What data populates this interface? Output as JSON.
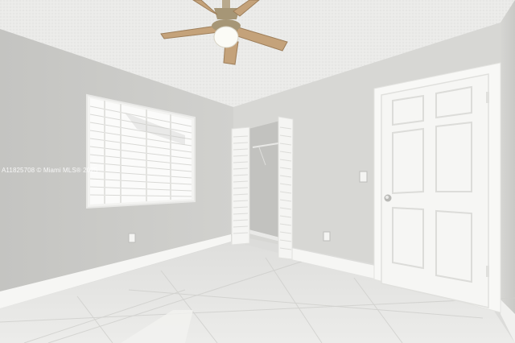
{
  "photo": {
    "watermark": "A11825708 © Miami MLS® 2025",
    "subject": "Empty bedroom with ceiling fan, window with blinds, bifold closet doors and a white paneled entry door"
  },
  "colors": {
    "ceiling": "#eaeae8",
    "left_wall": "#cbcbc8",
    "back_wall": "#d8d8d6",
    "right_wall": "#d2d2cf",
    "floor": "#e4e4e2",
    "trim": "#f6f6f4",
    "door": "#f7f7f5"
  },
  "icons": [
    "ceiling-fan-icon",
    "door-knob-icon",
    "light-switch-icon",
    "outlet-icon"
  ]
}
